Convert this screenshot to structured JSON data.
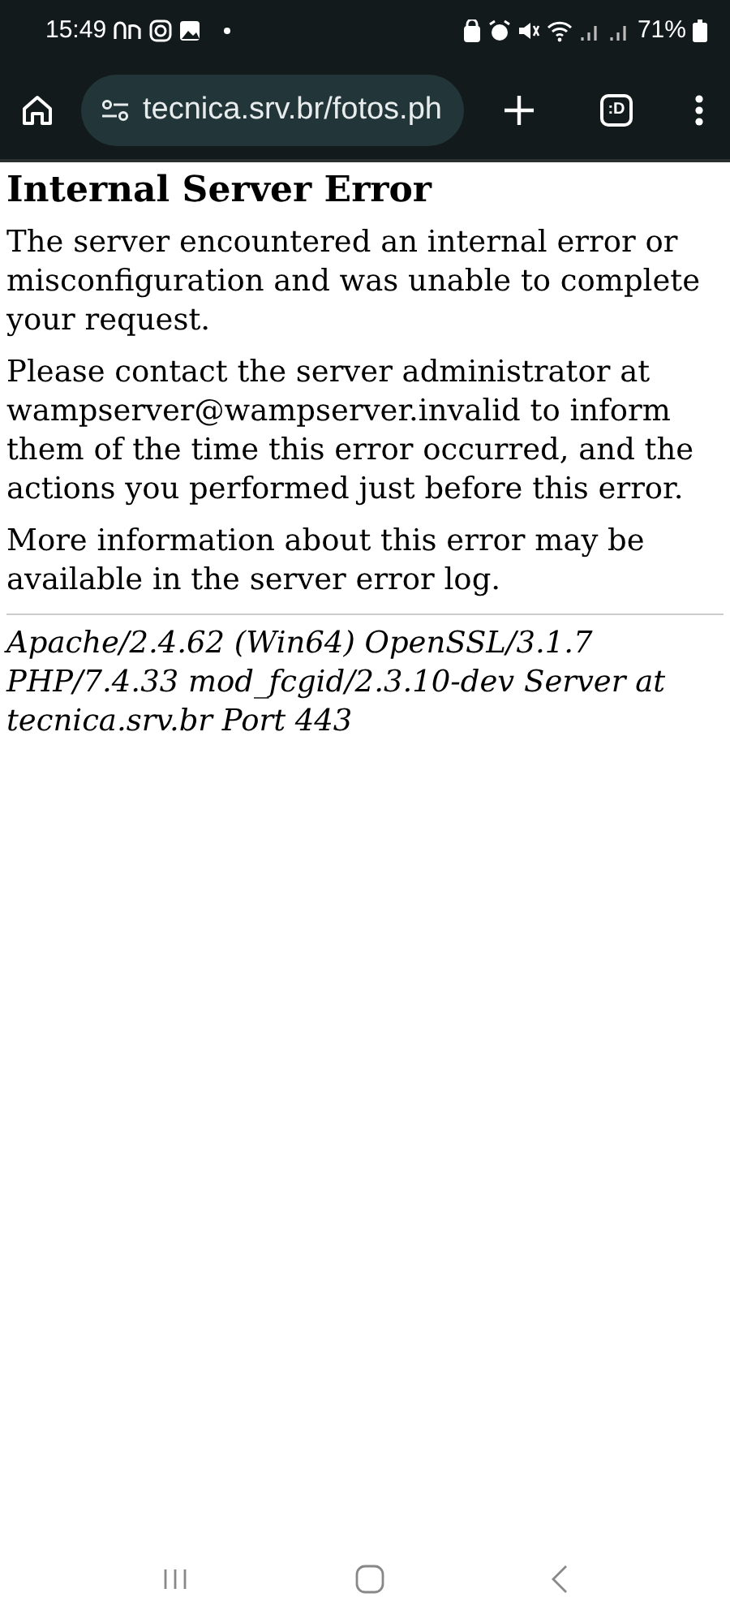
{
  "status_bar": {
    "time": "15:49",
    "battery": "71%"
  },
  "browser": {
    "url": "tecnica.srv.br/fotos.ph",
    "tab_count": ":D"
  },
  "page": {
    "title": "Internal Server Error",
    "paragraphs": [
      "The server encountered an internal error or misconfiguration and was unable to complete your request.",
      "Please contact the server administrator at wampserver@wampserver.invalid to inform them of the time this error occurred, and the actions you performed just before this error.",
      "More information about this error may be available in the server error log."
    ],
    "address": "Apache/2.4.62 (Win64) OpenSSL/3.1.7 PHP/7.4.33 mod_fcgid/2.3.10-dev Server at tecnica.srv.br Port 443"
  }
}
